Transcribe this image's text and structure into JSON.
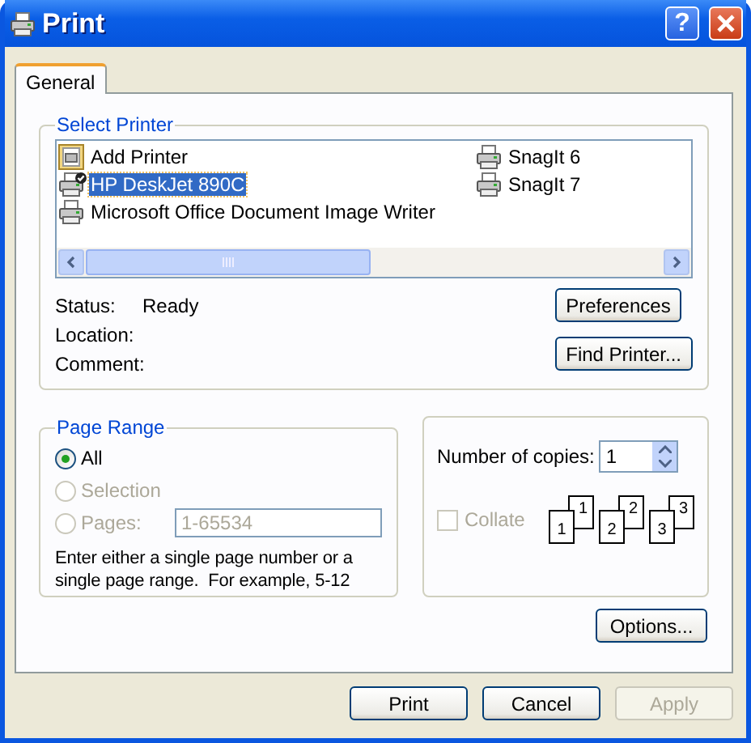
{
  "window": {
    "title": "Print",
    "help_button": "?"
  },
  "tabs": [
    {
      "label": "General",
      "selected": true
    }
  ],
  "select_printer": {
    "title": "Select Printer",
    "printers": [
      {
        "name": "Add Printer",
        "kind": "add",
        "selected": false,
        "default": false
      },
      {
        "name": "HP DeskJet 890C",
        "kind": "printer",
        "selected": true,
        "default": true
      },
      {
        "name": "Microsoft Office Document Image Writer",
        "kind": "printer",
        "selected": false,
        "default": false
      },
      {
        "name": "SnagIt 6",
        "kind": "printer",
        "selected": false,
        "default": false
      },
      {
        "name": "SnagIt 7",
        "kind": "printer",
        "selected": false,
        "default": false
      }
    ],
    "details": [
      {
        "label": "Status:",
        "value": "Ready"
      },
      {
        "label": "Location:"
      },
      {
        "label": "Comment:"
      }
    ],
    "buttons": [
      "Preferences",
      "Find Printer..."
    ]
  },
  "page_range": {
    "title": "Page Range",
    "options": [
      {
        "label": "All",
        "selected": true,
        "disabled": false
      },
      {
        "label": "Selection",
        "selected": false,
        "disabled": true
      },
      {
        "label": "Pages:",
        "selected": false,
        "disabled": true,
        "kind": "field"
      }
    ],
    "pages_field": {
      "value": "1-65534",
      "disabled": true
    },
    "hint": "Enter either a single page number or a single page range.  For example, 5-12"
  },
  "copies": {
    "label": "Number of copies:",
    "value": "1",
    "collate": {
      "label": "Collate",
      "checked": false,
      "disabled": true
    },
    "collate_sheets": [
      {
        "back": "1",
        "front": "1"
      },
      {
        "back": "2",
        "front": "2"
      },
      {
        "back": "3",
        "front": "3"
      }
    ]
  },
  "options_button": "Options...",
  "footer_buttons": [
    {
      "label": "Print",
      "disabled": false
    },
    {
      "label": "Cancel",
      "disabled": false
    },
    {
      "label": "Apply",
      "disabled": true
    }
  ]
}
